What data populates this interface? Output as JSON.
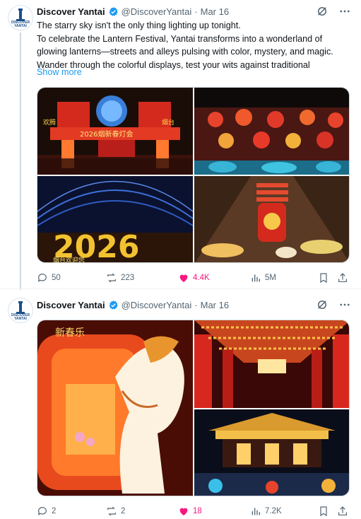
{
  "tweets": [
    {
      "account": {
        "name": "Discover Yantai",
        "handle": "@DiscoverYantai",
        "avatar_text": [
          "DISCOVER",
          "YANTAI"
        ]
      },
      "date": "Mar 16",
      "dot": "·",
      "lines": [
        "The starry sky isn't the only thing lighting up tonight.",
        "To celebrate the Lantern Festival, Yantai transforms into a wonderland of",
        "glowing lanterns—streets and alleys pulsing with color, mystery, and magic.",
        "Wander through the colorful displays, test your wits against traditional"
      ],
      "show_more": "Show more",
      "media_text": {
        "gate_banner": "2026烟新春灯会",
        "gate_left": "欢腾",
        "gate_right": "烟台",
        "year": "2026",
        "year_sub": "烟台欢迎您"
      },
      "stats": {
        "replies": "50",
        "reposts": "223",
        "likes": "4.4K",
        "views": "5M"
      }
    },
    {
      "account": {
        "name": "Discover Yantai",
        "handle": "@DiscoverYantai",
        "avatar_text": [
          "DISCOVER",
          "YANTAI"
        ]
      },
      "date": "Mar 16",
      "dot": "·",
      "media_text": {
        "horse_banner": "新春乐"
      },
      "stats": {
        "replies": "2",
        "reposts": "2",
        "likes": "18",
        "views": "7.2K"
      }
    }
  ],
  "icons": {
    "header": [
      "grok-icon",
      "more-icon"
    ],
    "actions": [
      "reply-icon",
      "repost-icon",
      "like-icon",
      "views-icon",
      "bookmark-icon",
      "share-icon"
    ]
  },
  "colors": {
    "accent": "#1d9bf0",
    "like": "#f91880",
    "muted": "#536471",
    "text": "#0f1419"
  }
}
